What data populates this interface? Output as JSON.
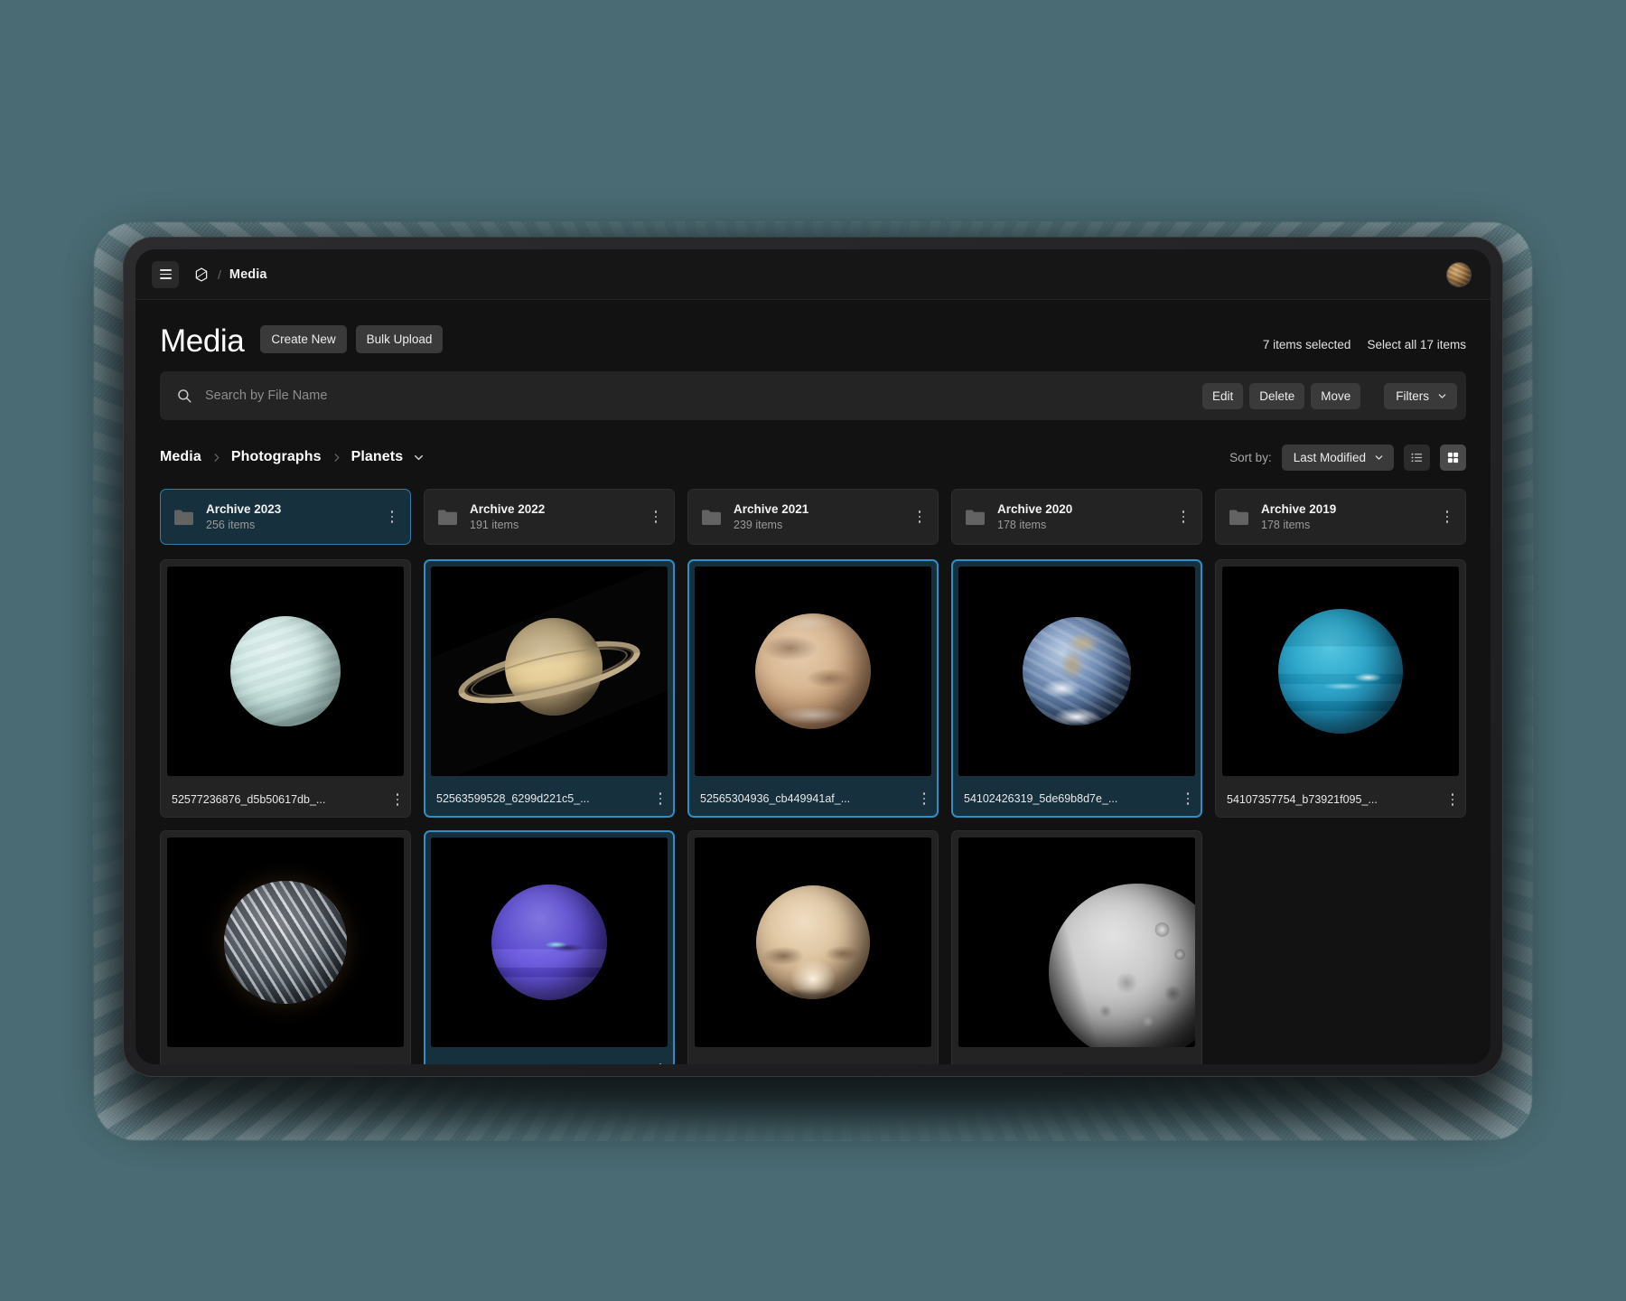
{
  "topbar": {
    "menu_icon": "hamburger-icon",
    "logo_icon": "app-logo-icon",
    "separator": "/",
    "breadcrumb_label": "Media",
    "avatar": "user-avatar"
  },
  "header": {
    "title": "Media",
    "create_new_label": "Create New",
    "bulk_upload_label": "Bulk Upload",
    "selected_text": "7 items selected",
    "select_all_text": "Select all 17 items"
  },
  "search": {
    "icon": "search-icon",
    "placeholder": "Search by File Name",
    "value": "",
    "edit_label": "Edit",
    "delete_label": "Delete",
    "move_label": "Move",
    "filters_label": "Filters"
  },
  "breadcrumbs": {
    "items": [
      {
        "label": "Media"
      },
      {
        "label": "Photographs"
      },
      {
        "label": "Planets"
      }
    ],
    "sort_by_label": "Sort by:",
    "sort_value": "Last Modified",
    "view_list_icon": "list-view-icon",
    "view_grid_icon": "grid-view-icon",
    "active_view": "grid"
  },
  "folders": [
    {
      "name": "Archive 2023",
      "count": "256 items",
      "selected": true
    },
    {
      "name": "Archive 2022",
      "count": "191 items",
      "selected": false
    },
    {
      "name": "Archive 2021",
      "count": "239 items",
      "selected": false
    },
    {
      "name": "Archive 2020",
      "count": "178 items",
      "selected": false
    },
    {
      "name": "Archive 2019",
      "count": "178 items",
      "selected": false
    }
  ],
  "files": [
    {
      "name": "52577236876_d5b50617db_...",
      "subject": "uranus",
      "selected": false
    },
    {
      "name": "52563599528_6299d221c5_...",
      "subject": "saturn",
      "selected": true
    },
    {
      "name": "52565304936_cb449941af_...",
      "subject": "mars",
      "selected": true
    },
    {
      "name": "54102426319_5de69b8d7e_...",
      "subject": "earth",
      "selected": true
    },
    {
      "name": "54107357754_b73921f095_...",
      "subject": "neptune-blue",
      "selected": false
    },
    {
      "name": "",
      "subject": "venus",
      "selected": false
    },
    {
      "name": "",
      "subject": "neptune-violet",
      "selected": true
    },
    {
      "name": "",
      "subject": "pluto",
      "selected": false
    },
    {
      "name": "",
      "subject": "moon",
      "selected": false
    }
  ],
  "colors": {
    "accent": "#2f8fc4",
    "selected_bg": "#16303d",
    "app_bg": "#121212",
    "card_bg": "#232323",
    "desktop_bg": "#4a6b73"
  }
}
